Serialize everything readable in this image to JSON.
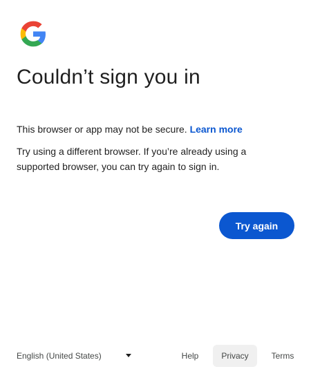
{
  "logo": {
    "icon": "google-g-logo-icon",
    "colors": [
      "#4285F4",
      "#EA4335",
      "#FBBC05",
      "#34A853"
    ]
  },
  "title": "Couldn’t sign you in",
  "message": {
    "text": "This browser or app may not be secure. ",
    "link": "Learn more"
  },
  "detail": "Try using a different browser. If you’re already using a supported browser, you can try again to sign in.",
  "actions": {
    "try_again": "Try again"
  },
  "footer": {
    "language": "English (United States)",
    "links": {
      "help": "Help",
      "privacy": "Privacy",
      "terms": "Terms"
    }
  },
  "colors": {
    "accent": "#0b57d0",
    "text": "#1f1f1f",
    "muted": "#444746"
  }
}
